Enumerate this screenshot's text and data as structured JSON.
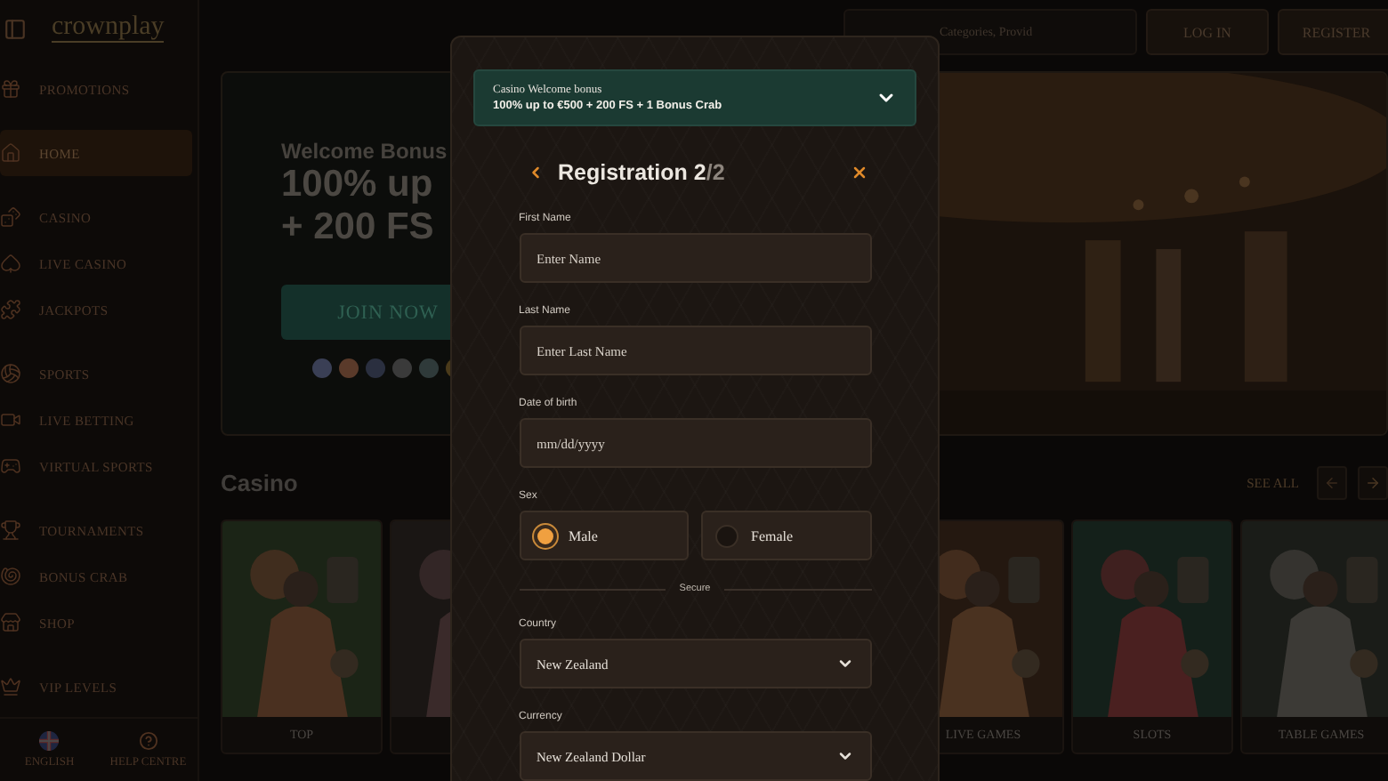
{
  "sidebar": {
    "logo": "crownplay",
    "groups": [
      [
        {
          "label": "PROMOTIONS",
          "selected": false
        }
      ],
      [
        {
          "label": "HOME",
          "selected": true
        }
      ],
      [
        {
          "label": "CASINO",
          "selected": false
        },
        {
          "label": "LIVE CASINO",
          "selected": false
        },
        {
          "label": "JACKPOTS",
          "selected": false
        }
      ],
      [
        {
          "label": "SPORTS",
          "selected": false
        },
        {
          "label": "LIVE BETTING",
          "selected": false
        },
        {
          "label": "VIRTUAL SPORTS",
          "selected": false
        }
      ],
      [
        {
          "label": "TOURNAMENTS",
          "selected": false
        },
        {
          "label": "BONUS CRAB",
          "selected": false
        },
        {
          "label": "SHOP",
          "selected": false
        }
      ],
      [
        {
          "label": "VIP LEVELS",
          "selected": false
        }
      ]
    ],
    "footer": {
      "language": "ENGLISH",
      "help": "HELP CENTRE"
    }
  },
  "topbar": {
    "search": {
      "placeholder": "Categories, Provid"
    },
    "login": "LOG IN",
    "register": "REGISTER"
  },
  "hero": {
    "eyebrow": "Welcome Bonus",
    "headline": [
      "100% up",
      "+ 200 FS"
    ],
    "button": "JOIN NOW"
  },
  "casino": {
    "title": "Casino",
    "see_all": "SEE ALL",
    "cards": [
      {
        "label": "TOP"
      },
      {
        "label": "LIVE GAMES"
      },
      {
        "label": "SLOTS"
      },
      {
        "label": "TABLE GAMES"
      }
    ]
  },
  "modal": {
    "bonus": {
      "title": "Casino Welcome bonus",
      "detail": "100% up to €500 + 200 FS + 1 Bonus Crab",
      "expanded": false
    },
    "heading": {
      "title": "Registration 2",
      "total": "/2"
    },
    "fields": [
      {
        "kind": "text",
        "label": "First Name",
        "placeholder": "Enter Name"
      },
      {
        "kind": "text",
        "label": "Last Name",
        "placeholder": "Enter Last Name"
      },
      {
        "kind": "text",
        "label": "Date of birth",
        "placeholder": "mm/dd/yyyy"
      },
      {
        "kind": "radio",
        "label": "Sex",
        "options": [
          {
            "label": "Male",
            "selected": true
          },
          {
            "label": "Female",
            "selected": false
          }
        ]
      },
      {
        "kind": "divider",
        "label": "Secure"
      },
      {
        "kind": "select",
        "label": "Country",
        "value": "New Zealand"
      },
      {
        "kind": "select",
        "label": "Currency",
        "value": "New Zealand Dollar"
      }
    ]
  }
}
